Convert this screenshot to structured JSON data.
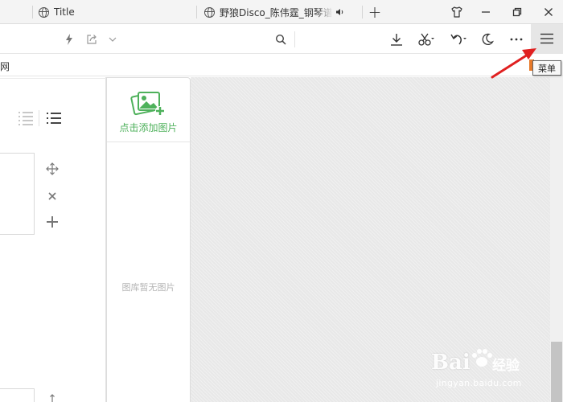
{
  "tabs": [
    {
      "title": "Title"
    },
    {
      "title": "野狼Disco_陈伟霆_钢琴谱"
    }
  ],
  "window_controls": {
    "new_tab": "+",
    "skin": "skin-icon",
    "minimize": "minimize-icon",
    "restore": "restore-icon",
    "close": "close-icon"
  },
  "bookmarks": {
    "visible_text": "网"
  },
  "tooltip": {
    "text": "菜单"
  },
  "gallery": {
    "add_label": "点击添加图片",
    "empty_text": "图库暂无图片"
  },
  "watermark": {
    "brand": "Bai",
    "brand_suffix": "经验",
    "url": "jingyan.baidu.com"
  },
  "colors": {
    "accent_green": "#4eb15b",
    "arrow_red": "#e02020",
    "menu_highlight": "#e6e6e6"
  }
}
